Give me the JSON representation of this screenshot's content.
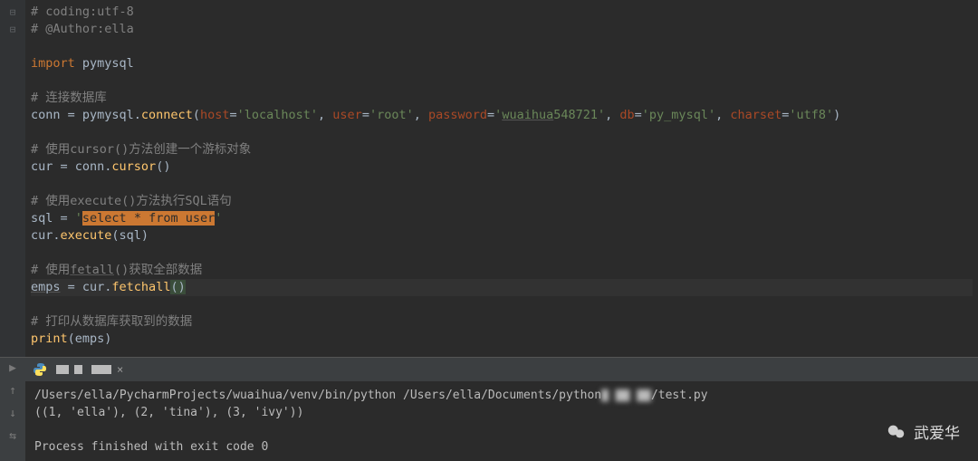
{
  "code": {
    "l1_comment": "# coding:utf-8",
    "l2_comment": "# @Author:ella",
    "l3_import_kw": "import",
    "l3_import_mod": " pymysql",
    "l4_comment": "# 连接数据库",
    "l5_a": "conn = pymysql.",
    "l5_connect": "connect",
    "l5_p_open": "(",
    "l5_host_k": "host",
    "l5_eq": "=",
    "l5_host_v": "'localhost'",
    "l5_comma": ", ",
    "l5_user_k": "user",
    "l5_user_v": "'root'",
    "l5_pw_k": "password",
    "l5_pw_v1": "'",
    "l5_pw_v2": "wuaihua",
    "l5_pw_v3": "548721'",
    "l5_db_k": "db",
    "l5_db_v": "'py_mysql'",
    "l5_cs_k": "charset",
    "l5_cs_v": "'utf8'",
    "l5_p_close": ")",
    "l6_comment": "# 使用cursor()方法创建一个游标对象",
    "l7_a": "cur = conn.",
    "l7_cursor": "cursor",
    "l7_paren": "()",
    "l8_comment": "# 使用execute()方法执行SQL语句",
    "l9_a": "sql = ",
    "l9_q1": "'",
    "l9_sql": "select * from user",
    "l9_q2": "'",
    "l10_a": "cur.",
    "l10_exec": "execute",
    "l10_b": "(sql)",
    "l11_comment": "# 使用",
    "l11_fetall": "fetall",
    "l11_comment2": "()获取全部数据",
    "l12_a": "emps",
    "l12_b": " = cur.",
    "l12_fetch": "fetchall",
    "l12_paren_o": "(",
    "l12_paren_c": ")",
    "l13_comment": "# 打印从数据库获取到的数据",
    "l14_print": "print",
    "l14_args": "(emps)"
  },
  "terminal": {
    "line1_a": "/Users/ella/PycharmProjects/wuaihua/venv/bin/python /Users/ella/Documents/python",
    "line1_blur": "▇ ▇▇ ▇▇",
    "line1_b": "/test.py",
    "line2": "((1, 'ella'), (2, 'tina'), (3, 'ivy'))",
    "line3": "",
    "line4": "Process finished with exit code 0"
  },
  "watermark": {
    "text": "武爱华"
  },
  "gutter": {
    "collapse": "⊟"
  }
}
